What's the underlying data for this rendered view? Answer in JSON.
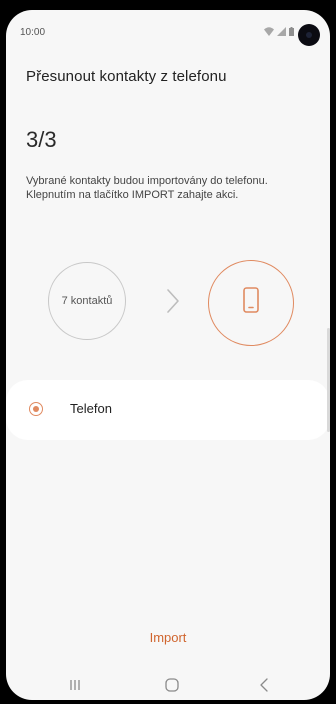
{
  "status_bar": {
    "time": "10:00",
    "icons": [
      "wifi-icon",
      "signal-icon",
      "battery-icon"
    ]
  },
  "header": {
    "title": "Přesunout kontakty z telefonu"
  },
  "step": {
    "counter": "3/3",
    "description": "Vybrané kontakty budou importovány do telefonu. Klepnutím na tlačítko IMPORT zahajte akci."
  },
  "transfer": {
    "source_label": "7 kontaktů",
    "arrow_icon": "chevron-right-icon",
    "target_icon": "smartphone-icon"
  },
  "options": [
    {
      "label": "Telefon",
      "selected": true
    }
  ],
  "actions": {
    "import_label": "Import"
  },
  "nav_bar": {
    "buttons": [
      "recents-icon",
      "home-icon",
      "back-icon"
    ]
  },
  "colors": {
    "accent": "#e08a60",
    "accent_text": "#d0652e",
    "background": "#f7f7f7",
    "card": "#ffffff"
  }
}
